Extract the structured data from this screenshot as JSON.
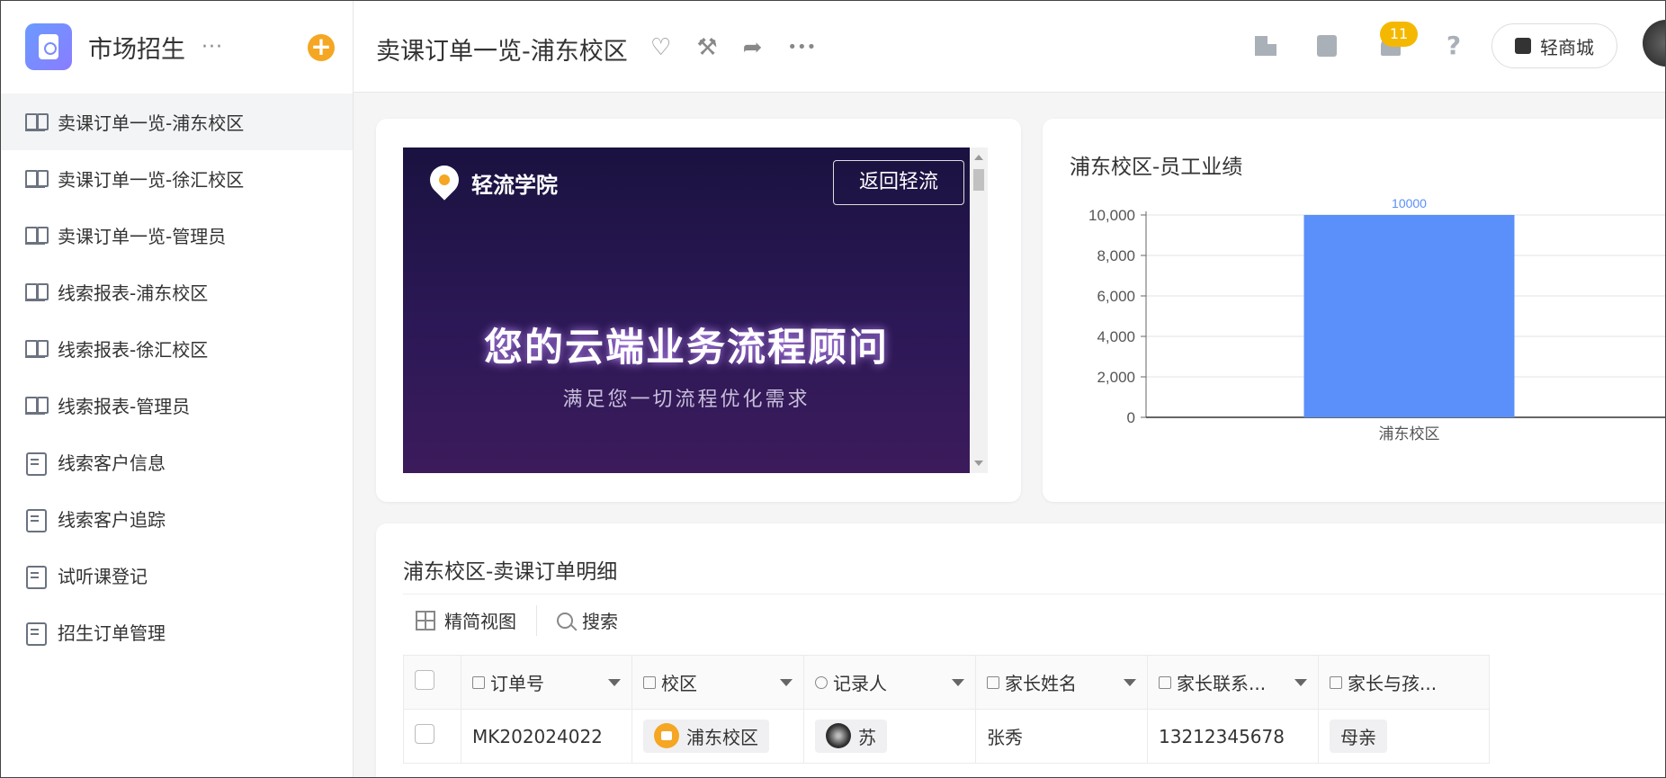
{
  "sidebar": {
    "app_title": "市场招生",
    "more": "···",
    "add": "+",
    "items": [
      {
        "label": "卖课订单一览-浦东校区",
        "icon": "report-icon"
      },
      {
        "label": "卖课订单一览-徐汇校区",
        "icon": "report-icon"
      },
      {
        "label": "卖课订单一览-管理员",
        "icon": "report-icon"
      },
      {
        "label": "线索报表-浦东校区",
        "icon": "report-icon"
      },
      {
        "label": "线索报表-徐汇校区",
        "icon": "report-icon"
      },
      {
        "label": "线索报表-管理员",
        "icon": "report-icon"
      },
      {
        "label": "线索客户信息",
        "icon": "form-icon"
      },
      {
        "label": "线索客户追踪",
        "icon": "form-icon"
      },
      {
        "label": "试听课登记",
        "icon": "form-icon"
      },
      {
        "label": "招生订单管理",
        "icon": "form-icon"
      }
    ]
  },
  "header": {
    "title": "卖课订单一览-浦东校区",
    "notification_count": "11",
    "shop_label": "轻商城",
    "help": "?",
    "more": "•••"
  },
  "banner": {
    "brand": "轻流学院",
    "back_button": "返回轻流",
    "headline": "您的云端业务流程顾问",
    "subline": "满足您一切流程优化需求"
  },
  "chart_data": {
    "type": "bar",
    "title": "浦东校区-员工业绩",
    "categories": [
      "浦东校区"
    ],
    "values": [
      10000
    ],
    "data_labels": [
      "10000"
    ],
    "ylim": [
      0,
      10000
    ],
    "yticks": [
      "0",
      "2,000",
      "4,000",
      "6,000",
      "8,000",
      "10,000"
    ],
    "bar_color": "#5b8ff9",
    "grid": true
  },
  "table": {
    "title": "浦东校区-卖课订单明细",
    "toolbar": {
      "view": "精简视图",
      "search": "搜索"
    },
    "columns": [
      "订单号",
      "校区",
      "记录人",
      "家长姓名",
      "家长联系...",
      "家长与孩..."
    ],
    "rows": [
      {
        "order": "MK202024022",
        "campus": "浦东校区",
        "recorder": "苏",
        "parent": "张秀",
        "phone": "13212345678",
        "relation": "母亲"
      }
    ]
  },
  "colors": {
    "accent": "#f5a623",
    "bar": "#5b8ff9",
    "badge": "#f5b800"
  }
}
